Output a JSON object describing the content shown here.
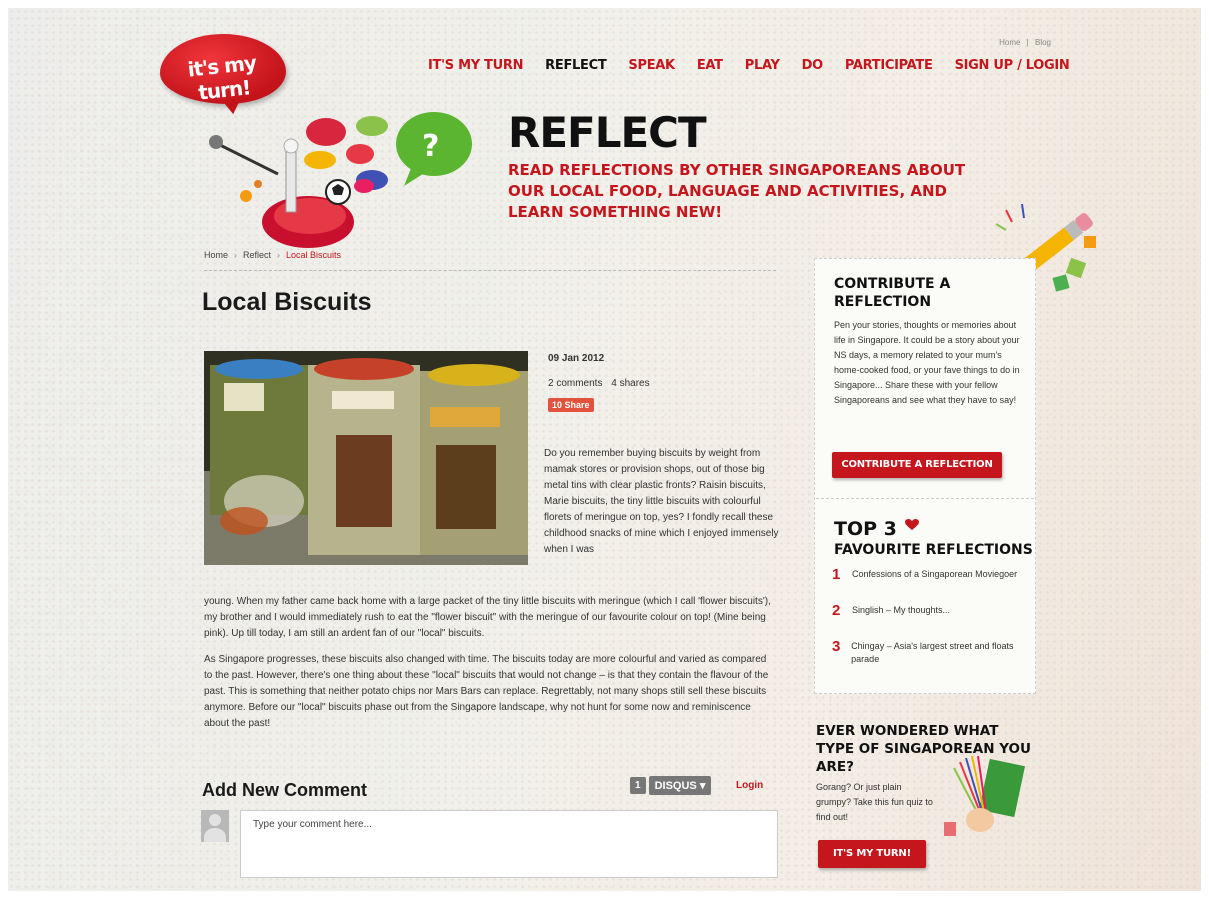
{
  "logo": {
    "text": "it's my turn!"
  },
  "utility_links": [
    "Home",
    "|",
    "Blog"
  ],
  "nav": [
    {
      "label": "IT'S MY TURN",
      "active": false
    },
    {
      "label": "REFLECT",
      "active": true
    },
    {
      "label": "SPEAK",
      "active": false
    },
    {
      "label": "EAT",
      "active": false
    },
    {
      "label": "PLAY",
      "active": false
    },
    {
      "label": "DO",
      "active": false
    },
    {
      "label": "PARTICIPATE",
      "active": false
    },
    {
      "label": "SIGN UP / LOGIN",
      "active": false
    }
  ],
  "hero": {
    "title": "REFLECT",
    "subtitle": "READ REFLECTIONS BY OTHER SINGAPOREANS ABOUT OUR LOCAL FOOD, LANGUAGE AND ACTIVITIES, AND LEARN SOMETHING NEW!"
  },
  "breadcrumb": [
    "Home",
    "Reflect",
    "Local Biscuits"
  ],
  "article": {
    "title": "Local Biscuits",
    "date": "09 Jan 2012",
    "comments": "2 comments",
    "shares": "4 shares",
    "share_button": "10 Share",
    "intro": "Do you remember buying biscuits by weight from mamak stores or provision shops, out of those big metal tins with clear plastic fronts? Raisin biscuits, Marie biscuits, the tiny little biscuits with colourful florets of meringue on top, yes? I fondly recall these childhood snacks of mine which I enjoyed immensely when I was",
    "paragraph1": "young. When my father came back home with a large packet of the tiny little biscuits with meringue (which I call 'flower biscuits'), my brother and I would immediately rush to eat the \"flower biscuit\" with the meringue of our favourite colour on top! (Mine being pink). Up till today, I am still an ardent fan of our \"local\" biscuits.",
    "paragraph2": "As Singapore progresses, these biscuits also changed with time. The biscuits today are more colourful and varied as compared to the past. However, there's one thing about these \"local\" biscuits that would not change – is that they contain the flavour of the past. This is something that neither potato chips nor Mars Bars can replace. Regrettably, not many shops still sell these biscuits anymore. Before our \"local\" biscuits phase out from the Singapore landscape, why not hunt for some now and reminiscence about the past!"
  },
  "comments": {
    "heading": "Add New Comment",
    "count_badge": "1",
    "disqus_label": "DISQUS",
    "login": "Login",
    "placeholder": "Type your comment here..."
  },
  "sidebar": {
    "contribute_title": "CONTRIBUTE A REFLECTION",
    "contribute_text": "Pen your stories, thoughts or memories about life in Singapore. It could be a story about your NS days, a memory related to your mum's home-cooked food, or your fave things to do in Singapore... Share these with your fellow Singaporeans and see what they have to say!",
    "contribute_button": "CONTRIBUTE A REFLECTION",
    "top3_big": "TOP 3",
    "top3_small": "FAVOURITE REFLECTIONS",
    "top3": [
      {
        "num": "1",
        "title": "Confessions of a Singaporean Moviegoer"
      },
      {
        "num": "2",
        "title": "Singlish – My thoughts..."
      },
      {
        "num": "3",
        "title": "Chingay – Asia's largest street and floats parade"
      }
    ],
    "quiz_title": "EVER WONDERED WHAT TYPE OF SINGAPOREAN YOU ARE?",
    "quiz_text": "Gorang? Or just plain grumpy? Take this fun quiz to find out!",
    "quiz_button": "IT'S MY TURN!"
  },
  "colors": {
    "accent": "#c4161c",
    "text": "#333333"
  }
}
